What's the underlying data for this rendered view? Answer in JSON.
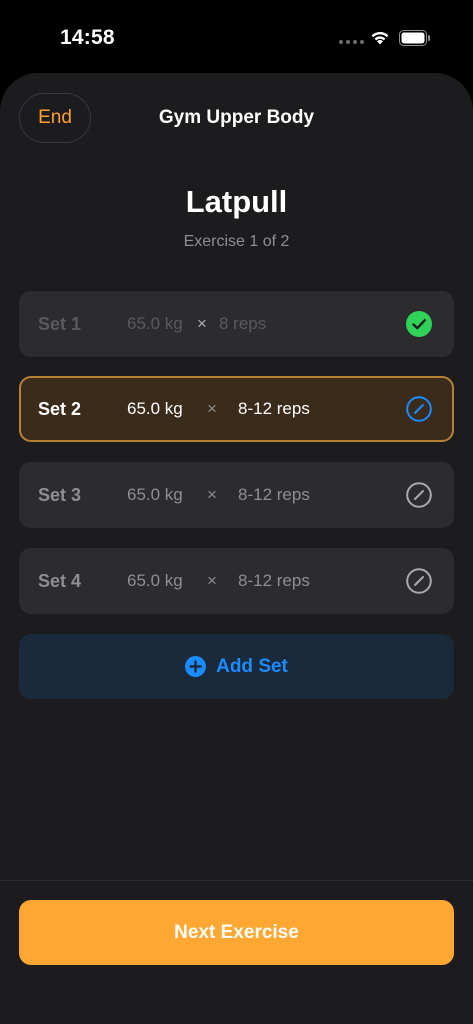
{
  "status_bar": {
    "time": "14:58",
    "icons": [
      "cellular-dots-icon",
      "wifi-icon",
      "battery-icon"
    ]
  },
  "header": {
    "end_label": "End",
    "workout_title": "Gym Upper Body"
  },
  "exercise": {
    "name": "Latpull",
    "progress": "Exercise 1 of 2"
  },
  "sets": [
    {
      "label": "Set 1",
      "weight": "65.0 kg",
      "times": "×",
      "reps": "8 reps",
      "state": "completed",
      "icon": "checkmark-circle-icon"
    },
    {
      "label": "Set 2",
      "weight": "65.0 kg",
      "times": "×",
      "reps": "8-12 reps",
      "state": "active",
      "icon": "edit-circle-icon"
    },
    {
      "label": "Set 3",
      "weight": "65.0 kg",
      "times": "×",
      "reps": "8-12 reps",
      "state": "pending",
      "icon": "edit-circle-icon"
    },
    {
      "label": "Set 4",
      "weight": "65.0 kg",
      "times": "×",
      "reps": "8-12 reps",
      "state": "pending",
      "icon": "edit-circle-icon"
    }
  ],
  "add_set": {
    "label": "Add Set",
    "icon": "plus-circle-icon"
  },
  "footer": {
    "next_label": "Next Exercise"
  },
  "colors": {
    "accent_orange": "#ffa733",
    "accent_blue": "#1a8cff",
    "success_green": "#30d158",
    "background": "#1c1c1e",
    "row_background": "#2c2c2e"
  }
}
